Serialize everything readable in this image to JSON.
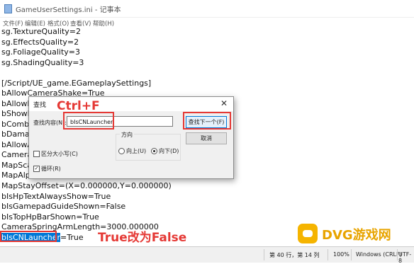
{
  "window": {
    "title": "GameUserSettings.ini - 记事本"
  },
  "menu": [
    "文件(F)",
    "编辑(E)",
    "格式(O)",
    "查看(V)",
    "帮助(H)"
  ],
  "editor": {
    "lines": [
      "sg.TextureQuality=2",
      "sg.EffectsQuality=2",
      "sg.FoliageQuality=3",
      "sg.ShadingQuality=3",
      "",
      "[/Script/UE_game.EGameplaySettings]",
      "bAllowCameraShake=True",
      "bAllowF",
      "bShowD",
      "bComb",
      "bDamag",
      "bAllowA",
      "Camera",
      "MapSca",
      "MapAlp",
      "MapStayOffset=(X=0.000000,Y=0.000000)",
      "bIsHpTextAlwaysShow=True",
      "bIsGamepadGuideShown=False",
      "bIsTopHpBarShown=True",
      "CameraSpringArmLength=3000.000000"
    ],
    "last_line": {
      "selected": "bIsCNLauncher",
      "rest": "=True"
    }
  },
  "find_dialog": {
    "title": "查找",
    "label": "查找内容(N):",
    "value": "bIsCNLauncher",
    "find_next": "查找下一个(F)",
    "cancel": "取消",
    "direction_label": "方向",
    "up": "向上(U)",
    "down": "向下(D)",
    "match_case": "区分大小写(C)",
    "wrap": "循环(R)"
  },
  "annotations": {
    "shortcut": "Ctrl+F",
    "instruction": "True改为False"
  },
  "status": {
    "position": "第 40 行，第 14 列",
    "zoom": "100%",
    "line_ending": "Windows (CRLF)",
    "encoding": "UTF-8"
  },
  "watermark": {
    "text": "DVG游戏网"
  },
  "colors": {
    "annotation": "#e53935",
    "selection": "#0078d7",
    "watermark": "#f5b400"
  }
}
